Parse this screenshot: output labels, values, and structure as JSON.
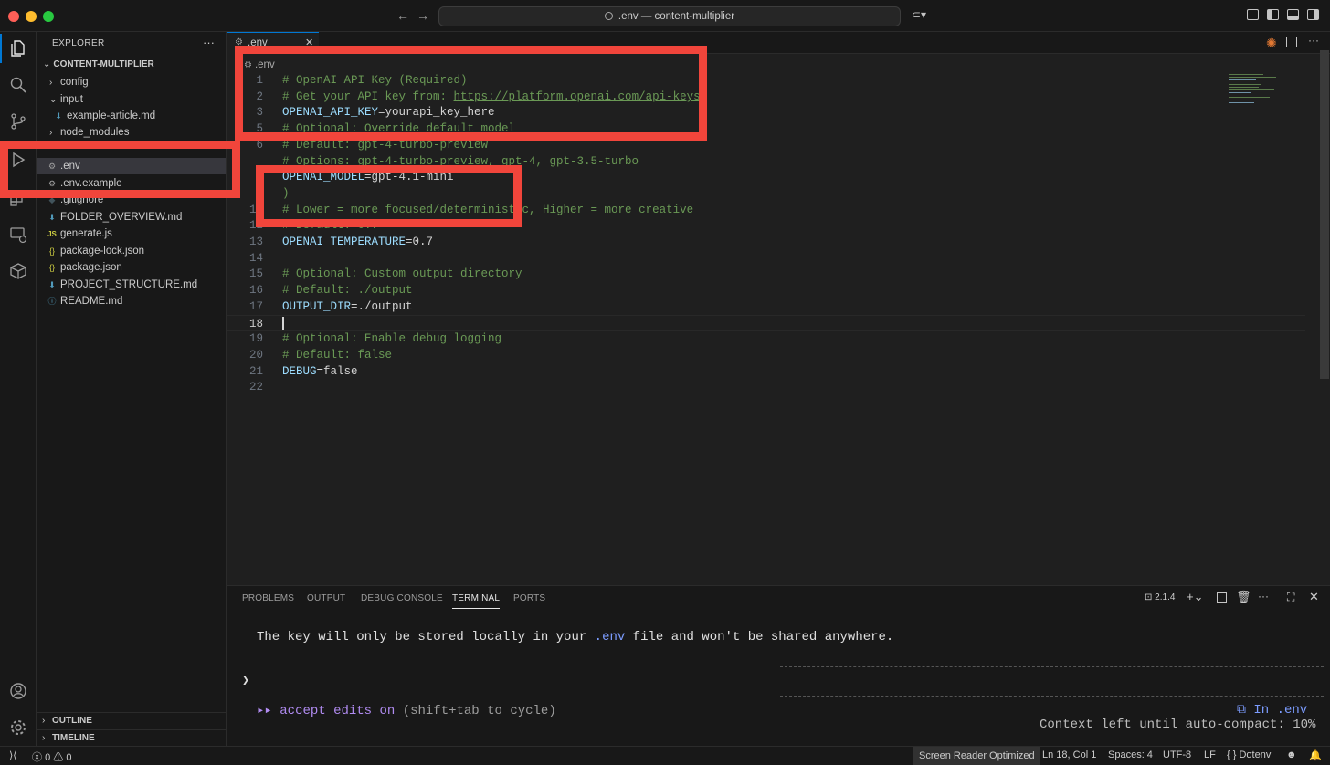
{
  "window": {
    "title": ".env — content-multiplier"
  },
  "sidebar": {
    "header": "EXPLORER",
    "more": "···",
    "project": "CONTENT-MULTIPLIER",
    "tree": [
      {
        "label": "config",
        "type": "folder",
        "icon": "chevron-right"
      },
      {
        "label": "input",
        "type": "folder-open",
        "icon": "chevron-down"
      },
      {
        "label": "example-article.md",
        "type": "file",
        "icon": "markdown-icon"
      },
      {
        "label": "node_modules",
        "type": "folder",
        "icon": "chevron-right"
      },
      {
        "label": ".env",
        "type": "file",
        "icon": "gear-icon",
        "selected": true
      },
      {
        "label": ".env.example",
        "type": "file",
        "icon": "gear-icon"
      },
      {
        "label": ".gitignore",
        "type": "file",
        "icon": "git-icon"
      },
      {
        "label": "FOLDER_OVERVIEW.md",
        "type": "file",
        "icon": "markdown-icon"
      },
      {
        "label": "generate.js",
        "type": "file",
        "icon": "js-icon"
      },
      {
        "label": "package-lock.json",
        "type": "file",
        "icon": "json-icon"
      },
      {
        "label": "package.json",
        "type": "file",
        "icon": "json-icon"
      },
      {
        "label": "PROJECT_STRUCTURE.md",
        "type": "file",
        "icon": "markdown-icon"
      },
      {
        "label": "README.md",
        "type": "file",
        "icon": "info-icon"
      }
    ],
    "outline": "OUTLINE",
    "timeline": "TIMELINE"
  },
  "editor": {
    "tab_label": ".env",
    "breadcrumb": ".env",
    "lines": [
      {
        "n": "1",
        "text": "# OpenAI API Key (Required)"
      },
      {
        "n": "2",
        "text": "# Get your API key from: ",
        "url": "https://platform.openai.com/api-keys"
      },
      {
        "n": "3",
        "key": "OPENAI_API_KEY",
        "value": "=yourapi_key_here"
      },
      {
        "n": "5",
        "text": "# Optional: Override default model"
      },
      {
        "n": "6",
        "text": "# Default: gpt-4-turbo-preview"
      },
      {
        "n": "",
        "text": "# Options: gpt-4-turbo-preview, gpt-4, gpt-3.5-turbo"
      },
      {
        "n": "",
        "key": "OPENAI_MODEL",
        "value": "=gpt-4.1-mini"
      },
      {
        "n": "1",
        "text": ")"
      },
      {
        "n": "11",
        "text": "# Lower = more focused/deterministic, Higher = more creative"
      },
      {
        "n": "12",
        "text": "# Default: 0.7"
      },
      {
        "n": "13",
        "key": "OPENAI_TEMPERATURE",
        "value": "=0.7"
      },
      {
        "n": "14",
        "text": ""
      },
      {
        "n": "15",
        "text": "# Optional: Custom output directory"
      },
      {
        "n": "16",
        "text": "# Default: ./output"
      },
      {
        "n": "17",
        "key": "OUTPUT_DIR",
        "value": "=./output"
      },
      {
        "n": "18",
        "text": "",
        "current": true
      },
      {
        "n": "19",
        "text": "# Optional: Enable debug logging"
      },
      {
        "n": "20",
        "text": "# Default: false"
      },
      {
        "n": "21",
        "key": "DEBUG",
        "value": "=false"
      },
      {
        "n": "22",
        "text": ""
      }
    ]
  },
  "panel": {
    "tabs": [
      "PROBLEMS",
      "OUTPUT",
      "DEBUG CONSOLE",
      "TERMINAL",
      "PORTS"
    ],
    "active_tab": "TERMINAL",
    "terminal_label": "2.1.4",
    "terminal": {
      "msg_before": "The key will only be stored locally in your ",
      "msg_highlight": ".env",
      "msg_after": " file and won't be shared anywhere.",
      "prompt": "❯",
      "mode_arrows": "▸▸",
      "mode_text": "accept edits on",
      "mode_hint": " (shift+tab to cycle)",
      "in_file": "⧉ In .env",
      "context": "Context left until auto-compact: 10%"
    }
  },
  "statusbar": {
    "errors": "0",
    "warnings": "0",
    "screen_reader": "Screen Reader Optimized",
    "position": "Ln 18, Col 1",
    "spaces": "Spaces: 4",
    "encoding": "UTF-8",
    "eol": "LF",
    "language": "{ } Dotenv"
  },
  "colors": {
    "accent": "#0078d4",
    "comment": "#6a9955",
    "key": "#9cdcfe",
    "highlight_box": "#f1453b"
  }
}
